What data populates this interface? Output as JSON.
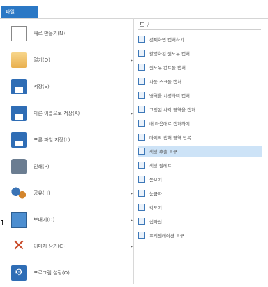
{
  "menu": {
    "file_tab": "파일"
  },
  "left_items": [
    {
      "label": "새로 만들기(N)",
      "has_arrow": false,
      "icon": "document-icon"
    },
    {
      "label": "열기(O)",
      "has_arrow": true,
      "icon": "folder-icon"
    },
    {
      "label": "저장(S)",
      "has_arrow": false,
      "icon": "save-icon"
    },
    {
      "label": "다른 이름으로 저장(A)",
      "has_arrow": true,
      "icon": "save-as-icon"
    },
    {
      "label": "프론 파일 저장(L)",
      "has_arrow": false,
      "icon": "save-copy-icon"
    },
    {
      "label": "인쇄(P)",
      "has_arrow": false,
      "icon": "printer-icon"
    },
    {
      "label": "공유(H)",
      "has_arrow": true,
      "icon": "share-icon"
    },
    {
      "label": "보내기(D)",
      "has_arrow": true,
      "icon": "send-icon"
    },
    {
      "label": "이미지 닫기(C)",
      "has_arrow": true,
      "icon": "close-x-icon"
    },
    {
      "label": "프로그램 설정(O)",
      "has_arrow": false,
      "icon": "settings-icon"
    }
  ],
  "right": {
    "title": "도구",
    "items": [
      {
        "label": "전체화면 캡처하기",
        "active": false
      },
      {
        "label": "활성화된 윈도우 캡처",
        "active": false
      },
      {
        "label": "윈도우 컨트롤 캡처",
        "active": false
      },
      {
        "label": "자동 스크롤 캡처",
        "active": false
      },
      {
        "label": "영역을 지정하여 캡처",
        "active": false
      },
      {
        "label": "고정된 사각 영역을 캡처",
        "active": false
      },
      {
        "label": "내 마음대로 캡처하기",
        "active": false
      },
      {
        "label": "마지막 캡처 영역 반복",
        "active": false
      },
      {
        "label": "색상 추출 도구",
        "active": true
      },
      {
        "label": "색상 팔레트",
        "active": false
      },
      {
        "label": "돋보기",
        "active": false
      },
      {
        "label": "눈금자",
        "active": false
      },
      {
        "label": "각도기",
        "active": false
      },
      {
        "label": "십자선",
        "active": false
      },
      {
        "label": "프리젠테이션 도구",
        "active": false
      }
    ]
  },
  "annotation": {
    "side_number": "1"
  }
}
